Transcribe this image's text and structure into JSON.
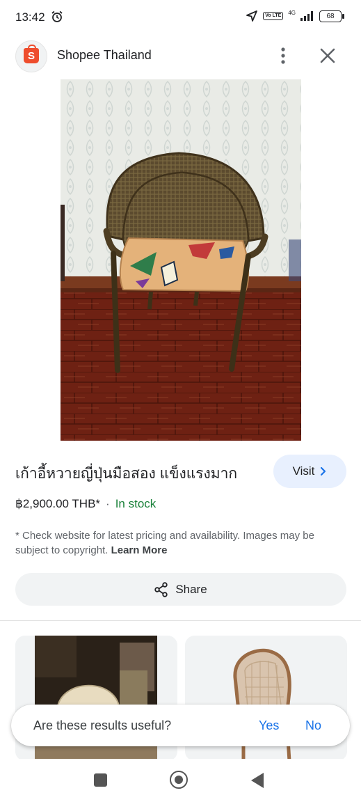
{
  "status_bar": {
    "time": "13:42",
    "network": "4G",
    "volte": "Vo LTE",
    "battery": "68"
  },
  "header": {
    "site_name": "Shopee Thailand",
    "logo_letter": "S",
    "brand_color": "#ee4d2d"
  },
  "product": {
    "title": "เก้าอี้หวายญี่ปุ่นมือสอง แข็งแรงมาก",
    "visit_label": "Visit",
    "price": "฿2,900.00 THB*",
    "separator": "·",
    "availability": "In stock",
    "availability_color": "#188038"
  },
  "disclaimer": {
    "text": "* Check website for latest pricing and availability. Images may be subject to copyright.",
    "link": "Learn More"
  },
  "share": {
    "label": "Share"
  },
  "feedback": {
    "question": "Are these results useful?",
    "yes": "Yes",
    "no": "No"
  }
}
